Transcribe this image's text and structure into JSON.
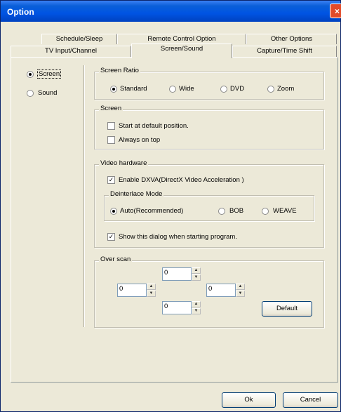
{
  "window": {
    "title": "Option",
    "close_label": "×"
  },
  "tabs_back": [
    "Schedule/Sleep",
    "Remote Control Option",
    "Other Options"
  ],
  "tabs_front": [
    "TV Input/Channel",
    "Screen/Sound",
    "Capture/Time Shift"
  ],
  "sidebar": {
    "screen_label": "Screen",
    "sound_label": "Sound"
  },
  "screen_ratio": {
    "legend": "Screen Ratio",
    "options": [
      "Standard",
      "Wide",
      "DVD",
      "Zoom"
    ]
  },
  "screen": {
    "legend": "Screen",
    "start_default": "Start at default position.",
    "always_on_top": "Always on top"
  },
  "video_hardware": {
    "legend": "Video hardware",
    "enable_dxva": "Enable DXVA(DirectX Video Acceleration )",
    "deinterlace_legend": "Deinterlace Mode",
    "deinterlace_options": [
      "Auto(Recommended)",
      "BOB",
      "WEAVE"
    ],
    "show_dialog": "Show this dialog when starting program."
  },
  "overscan": {
    "legend": "Over scan",
    "top": "0",
    "left": "0",
    "right": "0",
    "bottom": "0",
    "default_label": "Default"
  },
  "footer": {
    "ok_label": "Ok",
    "cancel_label": "Cancel"
  }
}
